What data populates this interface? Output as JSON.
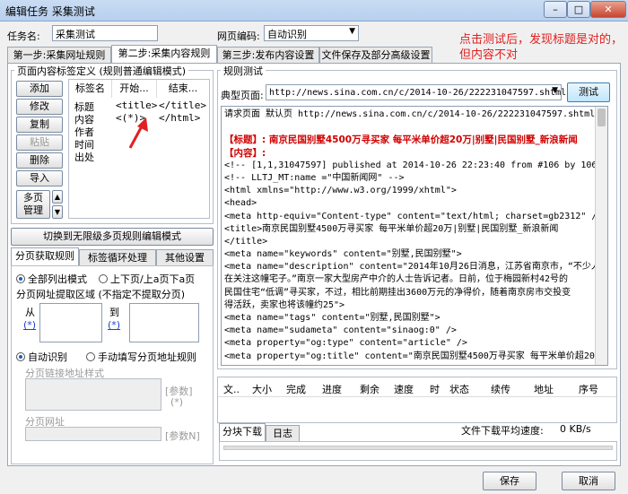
{
  "window": {
    "title": "编辑任务 采集测试",
    "min": "–",
    "max": "□",
    "close": "✕"
  },
  "task": {
    "label": "任务名:",
    "name": "采集测试",
    "encoding_label": "网页编码:",
    "encoding_value": "自动识别",
    "dropdown_icon": "chevron-down-icon"
  },
  "tabs": [
    "第一步:采集网址规则",
    "第二步:采集内容规则",
    "第三步:发布内容设置",
    "文件保存及部分高级设置"
  ],
  "annotation": "点击测试后，发现标题是对的，但内容不对",
  "left_panel": {
    "group_title": "页面内容标签定义  (规则普通编辑模式)",
    "buttons": [
      "添加",
      "修改",
      "复制",
      "粘贴",
      "删除",
      "导入"
    ],
    "multi_page_button": "多页\n管理",
    "table_headers": [
      "标签名",
      "开始...",
      "结束..."
    ],
    "rows": [
      {
        "name": "标题",
        "start": "<title>",
        "end": "</title>"
      },
      {
        "name": "内容",
        "start": "<(*)>",
        "end": "</html>"
      },
      {
        "name": "作者",
        "start": "",
        "end": ""
      },
      {
        "name": "时间",
        "start": "",
        "end": ""
      },
      {
        "name": "出处",
        "start": "",
        "end": ""
      }
    ],
    "switch_button": "切换到无限级多页规则编辑模式",
    "sub_tabs": [
      "分页获取规则",
      "标签循环处理",
      "其他设置"
    ],
    "paging_mode_all": "全部列出模式",
    "paging_mode_prev_next": "上下页/上a页下a页",
    "extract_area_label": "分页网址提取区域 (不指定不提取分页)",
    "from_label": "从",
    "to_label": "到",
    "star_link": "(*)",
    "auto_detect": "自动识别",
    "manual_rule": "手动填写分页地址规则",
    "link_rule_label": "分页链接地址样式",
    "param_label": "[参数]",
    "param_star": "(*)",
    "page_url_label": "分页网址",
    "param_n_label": "[参数N]"
  },
  "rule_test": {
    "group_title": "规则测试",
    "page_label": "典型页面:",
    "page_url": "http://news.sina.com.cn/c/2014-10-26/222231047597.shtml",
    "test_button": "测试",
    "output_lines": [
      "请求页面 默认页 http://news.sina.com.cn/c/2014-10-26/222231047597.shtml",
      "",
      "【标题】: 南京民国别墅4500万寻买家 每平米单价超20万|别墅|民国别墅_新浪新闻",
      "【内容】:",
      "<!-- [1,1,31047597] published at 2014-10-26 22:23:40 from #106 by 10608-->",
      "<!-- LLTJ_MT:name =\"中国新闻网\" -->",
      "<html xmlns=\"http://www.w3.org/1999/xhtml\">",
      "<head>",
      "<meta http-equiv=\"Content-type\" content=\"text/html; charset=gb2312\" />",
      "<title>南京民国别墅4500万寻买家 每平米单价超20万|别墅|民国别墅_新浪新闻",
      "</title>",
      "<meta name=\"keywords\" content=\"别墅,民国别墅\">",
      "<meta name=\"description\" content=\"2014年10月26日消息，江苏省南京市，“不少人都",
      "在关注这幢宅子。”南京一家大型房产中介的人士告诉记者。日前，位于梅园新村42号的",
      "民国住宅“低调”寻买家，不过，相比前期挂出3600万元的净得价，随着南京房市交投变",
      "得活跃，卖家也将该幢约25\">",
      "<meta name=\"tags\" content=\"别墅,民国别墅\">",
      "<meta name=\"sudameta\" content=\"sinaog:0\" />",
      "<meta property=\"og:type\" content=\"article\" />",
      "<meta property=\"og:title\" content=\"南京民国别墅4500万寻买家 每平米单价超20"
    ]
  },
  "download_table": {
    "headers": [
      "文..",
      "大小",
      "完成",
      "进度",
      "剩余",
      "速度",
      "时",
      "状态",
      "续传",
      "地址",
      "序号"
    ]
  },
  "bottom": {
    "tabs": [
      "分块下载",
      "日志"
    ],
    "avg_speed_label": "文件下载平均速度:",
    "avg_speed_value": "0 KB/s"
  },
  "footer": {
    "save": "保存",
    "cancel": "取消"
  }
}
